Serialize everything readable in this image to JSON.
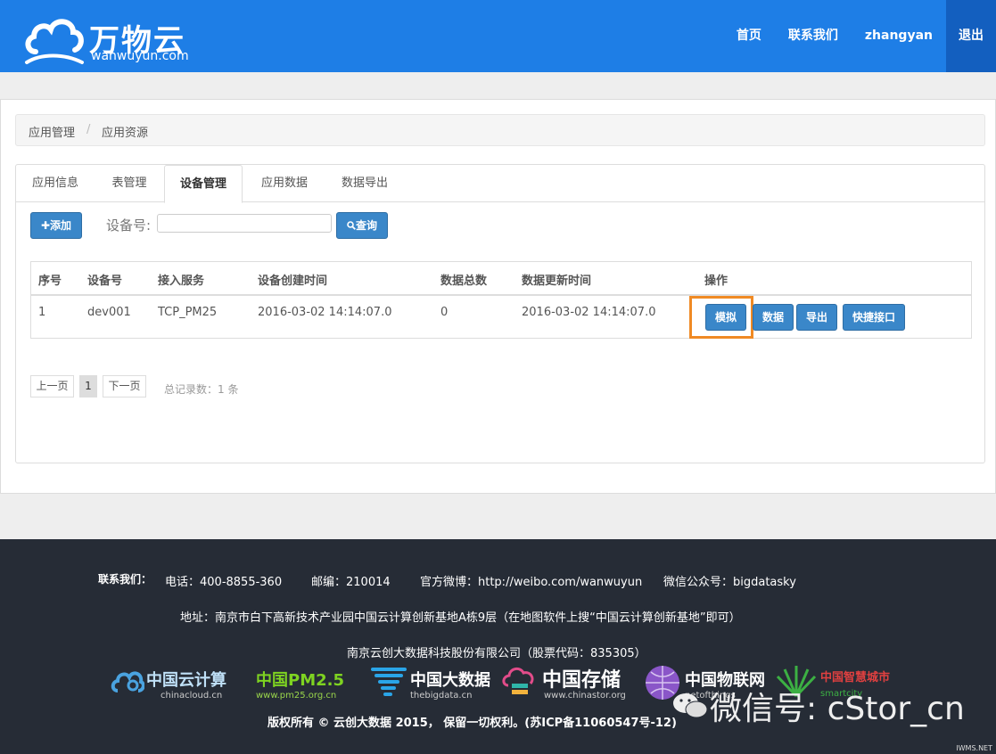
{
  "header": {
    "logo_title": "万物云",
    "logo_sub": "wanwuyun.com",
    "nav": [
      "首页",
      "联系我们",
      "zhangyan",
      "退出"
    ]
  },
  "breadcrumb": {
    "item1": "应用管理",
    "separator": "/",
    "item2": "应用资源"
  },
  "tabs": [
    "应用信息",
    "表管理",
    "设备管理",
    "应用数据",
    "数据导出"
  ],
  "toolbar": {
    "add_label": "✚添加",
    "device_label": "设备号:",
    "device_value": "",
    "query_label": "查询"
  },
  "table": {
    "headers": [
      "序号",
      "设备号",
      "接入服务",
      "设备创建时间",
      "数据总数",
      "数据更新时间",
      "操作"
    ],
    "rows": [
      [
        "1",
        "dev001",
        "TCP_PM25",
        "2016-03-02 14:14:07.0",
        "0",
        "2016-03-02 14:14:07.0"
      ]
    ],
    "actions": [
      "模拟",
      "数据",
      "导出",
      "快捷接口"
    ]
  },
  "pager": {
    "prev": "上一页",
    "current": "1",
    "next": "下一页",
    "total": "总记录数：1 条"
  },
  "footer": {
    "contact_label": "联系我们：",
    "phone": "电话：400-8855-360",
    "postcode": "邮编：210014",
    "weibo": "官方微博：http://weibo.com/wanwuyun",
    "wechat_account": "微信公众号：bigdatasky",
    "address": "地址：南京市白下高新技术产业园中国云计算创新基地A栋9层（在地图软件上搜“中国云计算创新基地”即可）",
    "company": "南京云创大数据科技股份有限公司（股票代码：835305）",
    "copyright": "版权所有 © 云创大数据 2015， 保留一切权利。(苏ICP备11060547号-12)",
    "partners": [
      {
        "name": "中国云计算",
        "sub": "chinacloud.cn"
      },
      {
        "name": "中国PM2.5",
        "sub": "www.pm25.org.cn"
      },
      {
        "name": "中国大数据",
        "sub": "thebigdata.cn"
      },
      {
        "name": "中国存储",
        "sub": "www.chinastor.org"
      },
      {
        "name": "中国物联网",
        "sub": "netofthings"
      },
      {
        "name": "中国智慧城市",
        "sub": "smartcity"
      }
    ],
    "wechat_watermark": "微信号: cStor_cn",
    "site_watermark": "IWMS.NET"
  },
  "colors": {
    "header_bg": "#1e7ee6",
    "logout_bg": "#135fbf",
    "button": "#3a87c9",
    "highlight": "#f08a24",
    "footer_bg": "#262c36"
  }
}
